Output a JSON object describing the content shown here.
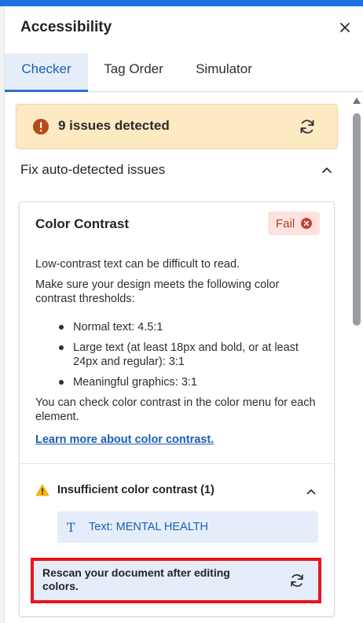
{
  "panel": {
    "title": "Accessibility",
    "close_icon": "close-icon"
  },
  "tabs": [
    {
      "label": "Checker",
      "active": true
    },
    {
      "label": "Tag Order",
      "active": false
    },
    {
      "label": "Simulator",
      "active": false
    }
  ],
  "alert": {
    "text": "9 issues detected",
    "icon": "error-circle-icon",
    "refresh_icon": "refresh-icon",
    "background": "#fde9c2"
  },
  "section": {
    "title": "Fix auto-detected issues",
    "chevron": "chevron-up-icon"
  },
  "card": {
    "title": "Color Contrast",
    "status": "Fail",
    "status_color": "#b23a28",
    "description_1": "Low-contrast text can be difficult to read.",
    "description_2": "Make sure your design meets the following color contrast thresholds:",
    "thresholds": [
      "Normal text: 4.5:1",
      "Large text (at least 18px and bold, or at least 24px and regular): 3:1",
      "Meaningful graphics: 3:1"
    ],
    "description_3": "You can check color contrast in the color menu for each element.",
    "learn_more": "Learn more about color contrast."
  },
  "issue": {
    "title": "Insufficient color contrast (1)",
    "icon": "warning-icon",
    "element": {
      "icon": "T",
      "label": "Text: MENTAL HEALTH"
    }
  },
  "rescan": {
    "text": "Rescan your document after editing colors.",
    "icon": "refresh-icon",
    "highlight_color": "#e8141c"
  }
}
